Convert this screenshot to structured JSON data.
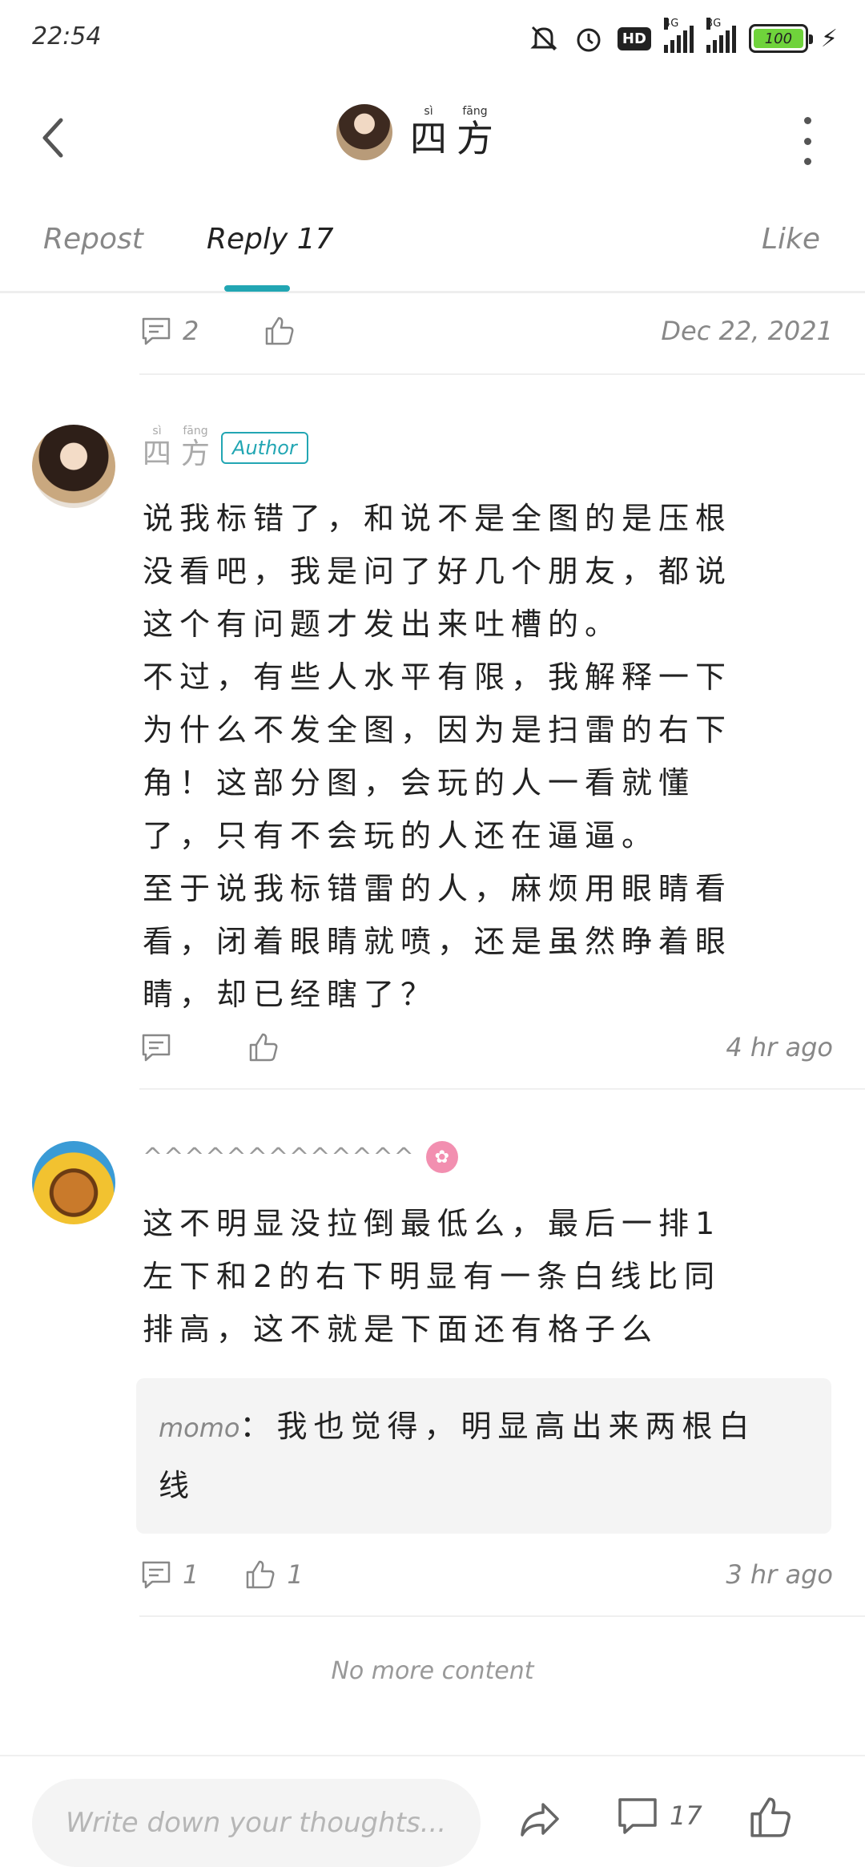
{
  "status": {
    "time": "22:54",
    "hd": "HD",
    "net1": "4G",
    "net2": "3G",
    "battery": "100"
  },
  "header": {
    "title_chars": [
      {
        "py": "sì",
        "hz": "四"
      },
      {
        "py": "fāng",
        "hz": "方"
      }
    ]
  },
  "tabs": {
    "repost": "Repost",
    "reply": "Reply 17",
    "like": "Like"
  },
  "post_actions": {
    "comment_count": "2",
    "date": "Dec 22, 2021"
  },
  "comments": [
    {
      "author": "四方",
      "author_py": [
        "sì",
        "fāng"
      ],
      "badge": "Author",
      "lines": [
        "说我标错了，和说不是全图的是压根",
        "没看吧，我是问了好几个朋友，都说",
        "这个有问题才发出来吐槽的。",
        "不过，有些人水平有限，我解释一下",
        "为什么不发全图，因为是扫雷的右下",
        "角！这部分图，会玩的人一看就懂",
        "了，只有不会玩的人还在逼逼。",
        "至于说我标错雷的人，麻烦用眼睛看",
        "看，闭着眼睛就喷，还是虽然睁着眼",
        "睛，却已经瞎了？"
      ],
      "comment_count": "",
      "like_count": "",
      "time": "4 hr ago"
    },
    {
      "author": "^^^^^^^^^^^^^",
      "lines": [
        "这不明显没拉倒最低么，最后一排1",
        "左下和2的右下明显有一条白线比同",
        "排高，这不就是下面还有格子么"
      ],
      "reply": {
        "user": "momo",
        "sep": "：",
        "lines": [
          "我也觉得，明显高出来两根白",
          "线"
        ]
      },
      "comment_count": "1",
      "like_count": "1",
      "time": "3 hr ago"
    }
  ],
  "footer": {
    "no_more": "No more content",
    "input_placeholder": "Write down your thoughts...",
    "comment_count": "17"
  },
  "colors": {
    "accent": "#22a6b3",
    "battery": "#6fd33b",
    "pink_badge": "#f28fb0"
  }
}
